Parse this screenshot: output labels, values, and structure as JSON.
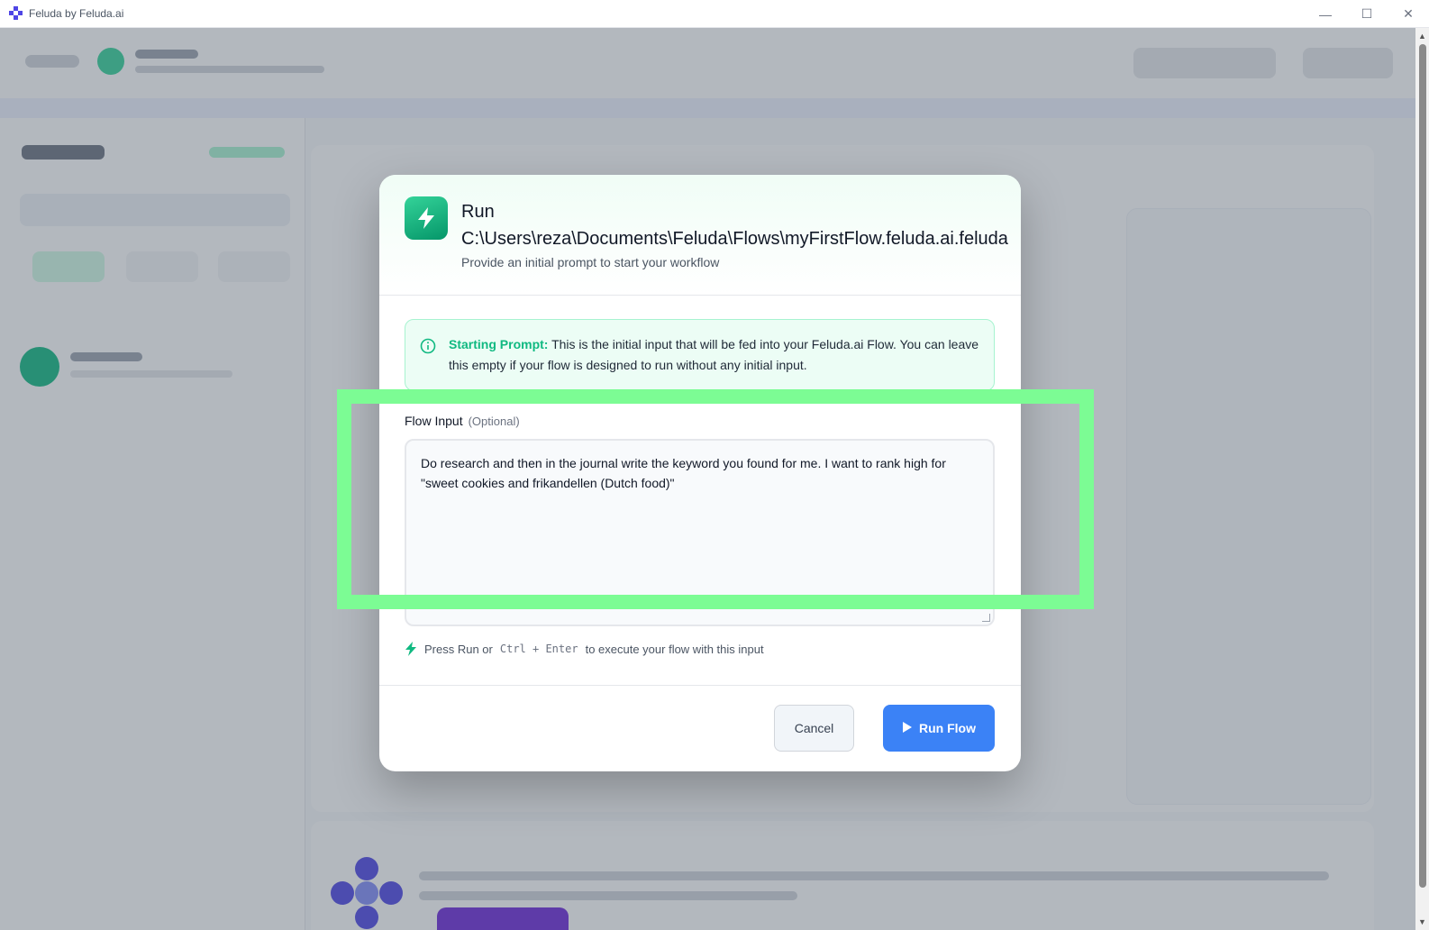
{
  "window": {
    "title": "Feluda by Feluda.ai",
    "minimize_icon": "minimize-icon",
    "maximize_icon": "maximize-icon",
    "close_icon": "close-icon"
  },
  "modal": {
    "title_prefix": "Run",
    "title_path": "C:\\Users\\reza\\Documents\\Feluda\\Flows\\myFirstFlow.feluda.ai.feluda",
    "subtitle": "Provide an initial prompt to start your workflow",
    "icon": "bolt-icon",
    "info": {
      "lead": "Starting Prompt:",
      "text": " This is the initial input that will be fed into your Feluda.ai Flow. You can leave this empty if your flow is designed to run without any initial input."
    },
    "field": {
      "label": "Flow Input",
      "optional": "(Optional)",
      "value": "Do research and then in the journal write the keyword you found for me. I want to rank high for \"sweet cookies and frikandellen (Dutch food)\""
    },
    "hint": {
      "before": "Press Run or",
      "shortcut": "Ctrl + Enter",
      "after": "to execute your flow with this input"
    },
    "buttons": {
      "cancel": "Cancel",
      "run": "Run Flow"
    }
  },
  "colors": {
    "accent_green": "#10b981",
    "primary_blue": "#3b82f6",
    "highlight": "#7cfc94"
  }
}
